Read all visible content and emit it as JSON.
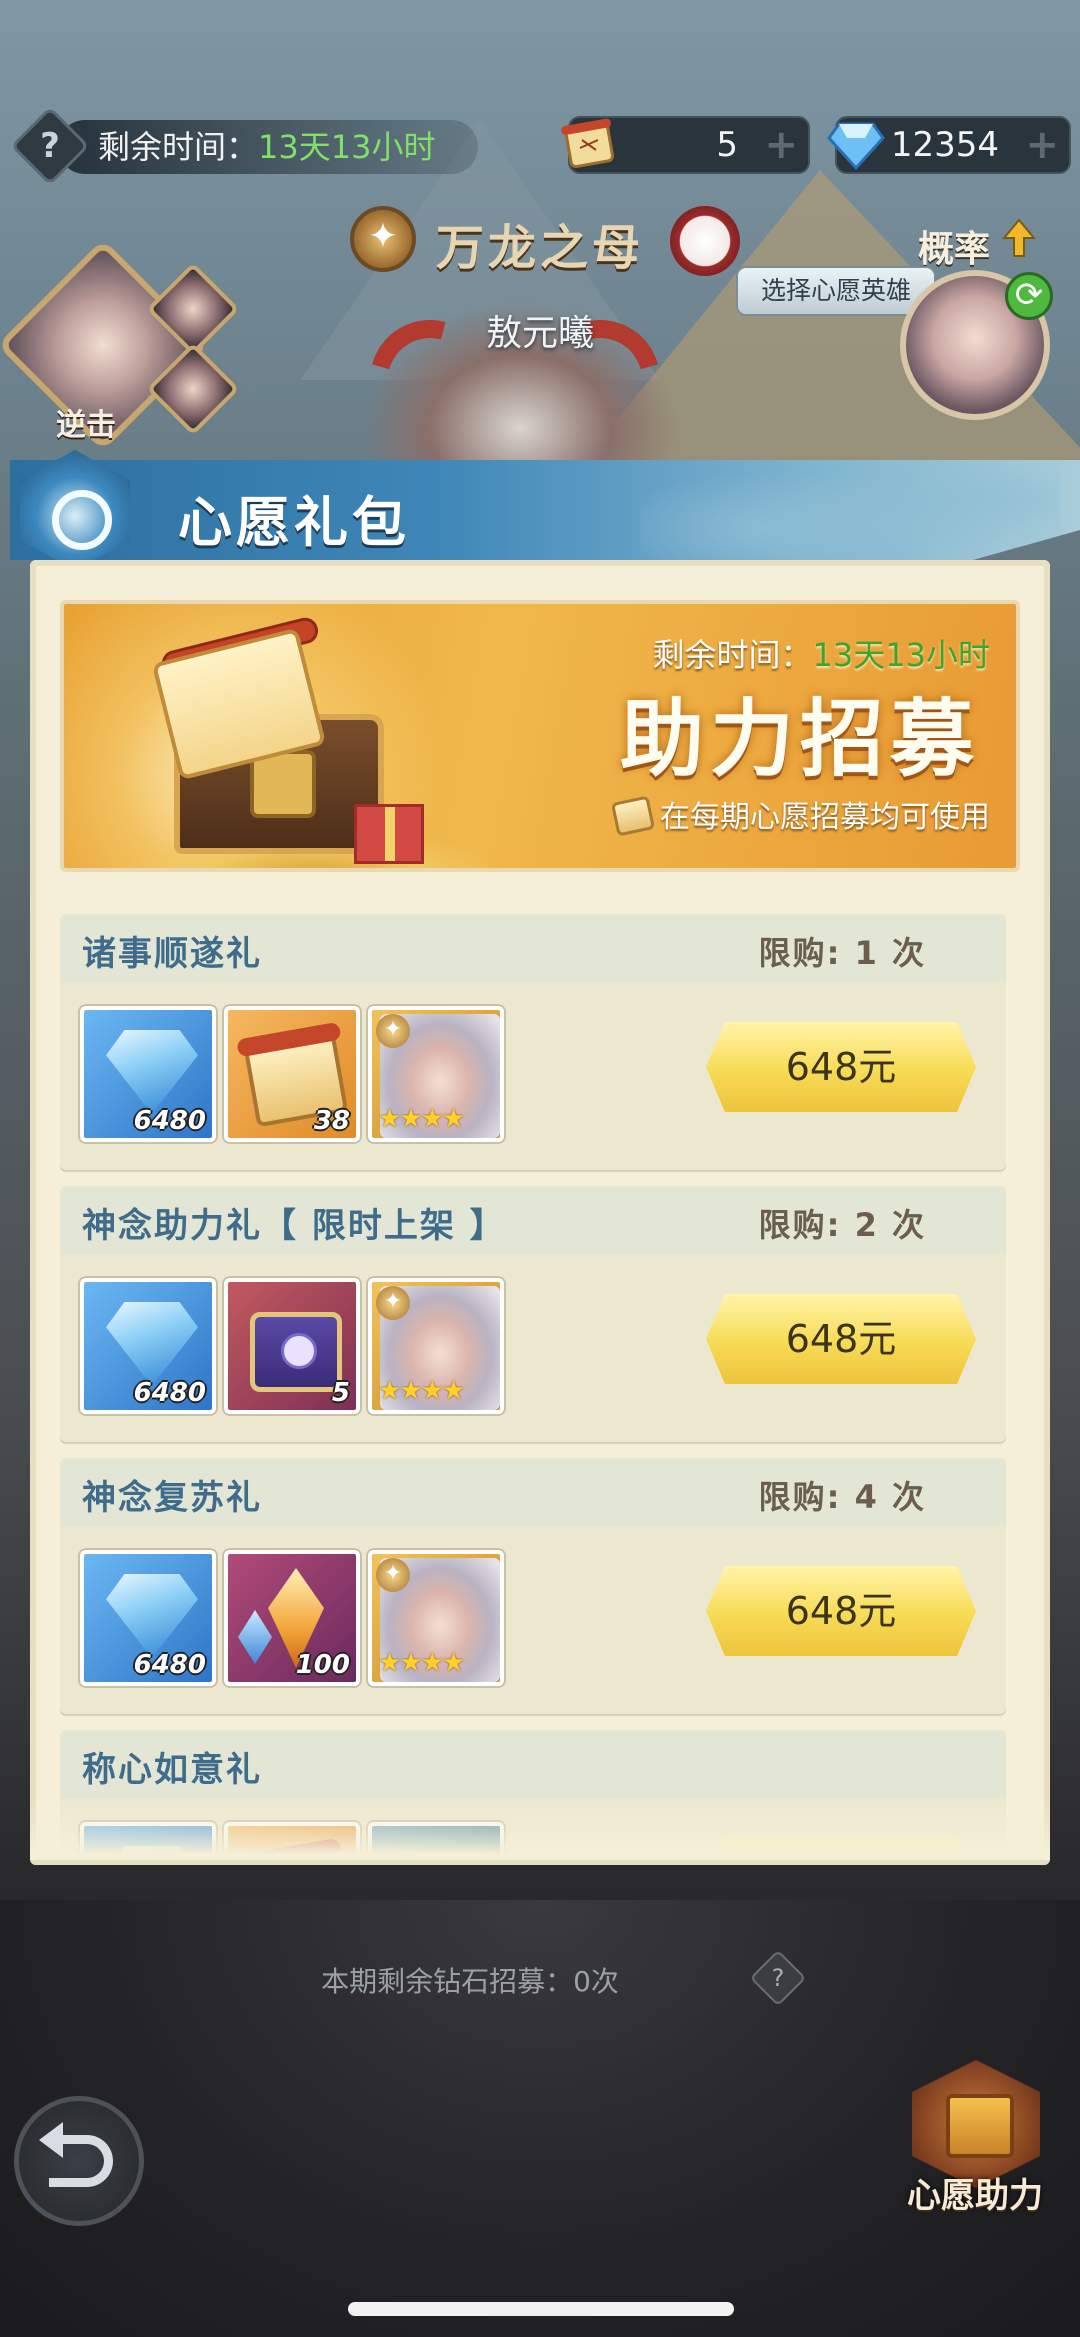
{
  "top_bar": {
    "timer_label": "剩余时间：",
    "timer_value": "13天13小时",
    "help_symbol": "?",
    "scroll_count": "5",
    "gem_count": "12354",
    "plus_symbol": "+"
  },
  "hero": {
    "name": "万龙之母",
    "subtitle": "敖元曦"
  },
  "left_panel": {
    "reverse_label": "逆击"
  },
  "right_panel": {
    "probability_label": "概率",
    "select_hero_label": "选择心愿英雄"
  },
  "dialog": {
    "title": "心愿礼包",
    "promo": {
      "timer_label": "剩余时间：",
      "timer_value": "13天13小时",
      "title": "助力招募",
      "note": "在每期心愿招募均可使用"
    },
    "packages": [
      {
        "name": "诸事顺遂礼",
        "limit": "限购: 1 次",
        "price": "648元",
        "items": [
          {
            "icon": "diamond-icon",
            "qty": "6480"
          },
          {
            "icon": "scroll-icon",
            "qty": "38"
          },
          {
            "icon": "hero-portrait",
            "stars": "★★★★"
          }
        ]
      },
      {
        "name": "神念助力礼【 限时上架 】",
        "limit": "限购: 2 次",
        "price": "648元",
        "items": [
          {
            "icon": "diamond-icon",
            "qty": "6480"
          },
          {
            "icon": "chest-icon",
            "qty": "5"
          },
          {
            "icon": "hero-portrait",
            "stars": "★★★★"
          }
        ]
      },
      {
        "name": "神念复苏礼",
        "limit": "限购: 4 次",
        "price": "648元",
        "items": [
          {
            "icon": "diamond-icon",
            "qty": "6480"
          },
          {
            "icon": "crystal-icon",
            "qty": "100"
          },
          {
            "icon": "hero-portrait",
            "stars": "★★★★"
          }
        ]
      },
      {
        "name": "称心如意礼",
        "limit": "",
        "price": "",
        "items": [
          {
            "icon": "diamond-icon",
            "qty": ""
          },
          {
            "icon": "scroll-icon",
            "qty": ""
          },
          {
            "icon": "hero-portrait",
            "qty": ""
          }
        ]
      }
    ]
  },
  "bottom": {
    "remaining_recruit": "本期剩余钻石招募：0次",
    "help_symbol": "?",
    "wish_assist_label": "心愿助力"
  },
  "colors": {
    "accent_blue": "#3f87b8",
    "panel_bg": "#f5efd8",
    "timer_green": "#7fe06a",
    "button_yellow": "#f7db55"
  }
}
